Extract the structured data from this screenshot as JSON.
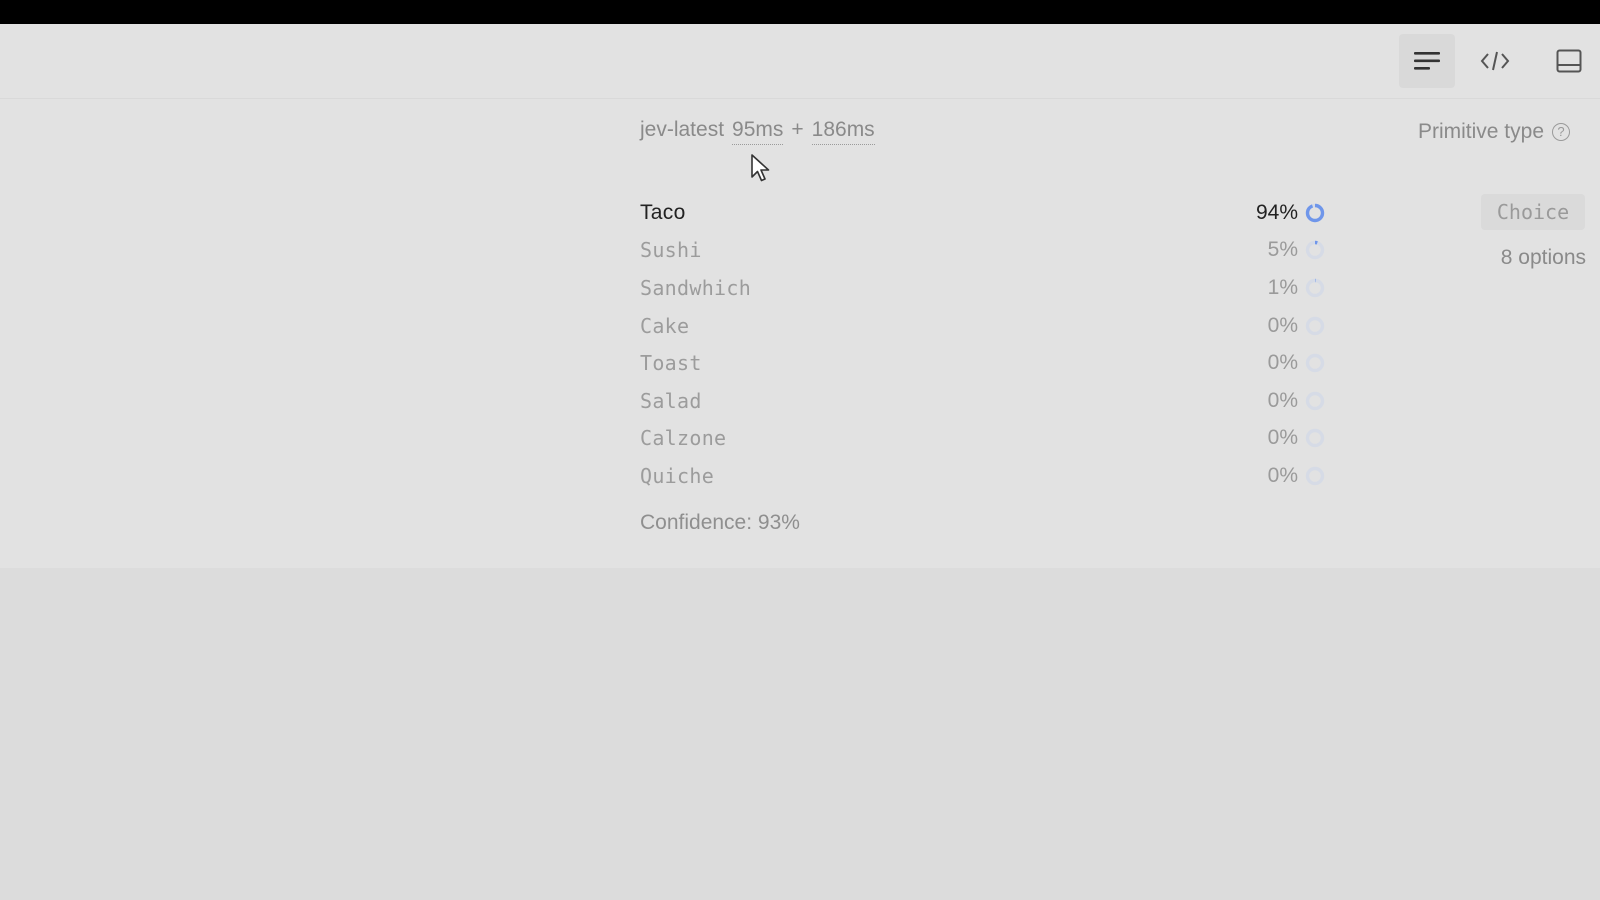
{
  "toolbar": {
    "buttons": [
      {
        "icon": "lines-icon",
        "active": true
      },
      {
        "icon": "code-icon",
        "active": false
      },
      {
        "icon": "panel-icon",
        "active": false
      }
    ]
  },
  "header": {
    "model": "jev-latest",
    "timing_1": "95ms",
    "plus": "+",
    "timing_2": "186ms"
  },
  "primitive": {
    "label": "Primitive type",
    "help_glyph": "?",
    "type": "Choice",
    "options_count": "8 options"
  },
  "results": [
    {
      "label": "Taco",
      "percent": "94%",
      "value": 0.94
    },
    {
      "label": "Sushi",
      "percent": "5%",
      "value": 0.05
    },
    {
      "label": "Sandwhich",
      "percent": "1%",
      "value": 0.01
    },
    {
      "label": "Cake",
      "percent": "0%",
      "value": 0
    },
    {
      "label": "Toast",
      "percent": "0%",
      "value": 0
    },
    {
      "label": "Salad",
      "percent": "0%",
      "value": 0
    },
    {
      "label": "Calzone",
      "percent": "0%",
      "value": 0
    },
    {
      "label": "Quiche",
      "percent": "0%",
      "value": 0
    }
  ],
  "confidence": "Confidence: 93%",
  "colors": {
    "accent": "#6f96ea",
    "ring_track": "#d6dbe6"
  }
}
